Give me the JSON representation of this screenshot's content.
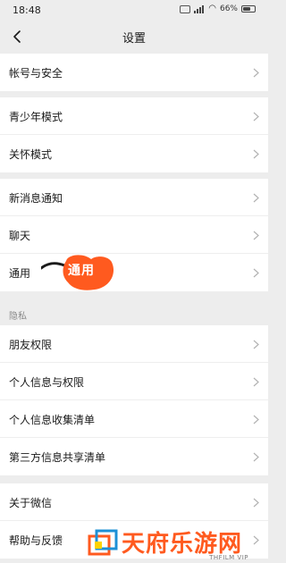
{
  "status_bar": {
    "time": "18:48",
    "battery": "66%",
    "battery_level": 0.66
  },
  "nav": {
    "title": "设置"
  },
  "groups": [
    {
      "items": [
        {
          "label": "帐号与安全"
        }
      ]
    },
    {
      "items": [
        {
          "label": "青少年模式"
        },
        {
          "label": "关怀模式"
        }
      ]
    },
    {
      "items": [
        {
          "label": "新消息通知"
        },
        {
          "label": "聊天"
        },
        {
          "label": "通用"
        }
      ]
    },
    {
      "header": "隐私",
      "items": [
        {
          "label": "朋友权限"
        },
        {
          "label": "个人信息与权限"
        },
        {
          "label": "个人信息收集清单"
        },
        {
          "label": "第三方信息共享清单"
        }
      ]
    },
    {
      "items": [
        {
          "label": "关于微信"
        },
        {
          "label": "帮助与反馈"
        }
      ]
    }
  ],
  "annotation": {
    "text": "通用",
    "color": "#ff5a1f"
  },
  "watermark": {
    "text": "天府乐游网",
    "sub": "THFILM VIP",
    "color": "#ff5a1f"
  }
}
